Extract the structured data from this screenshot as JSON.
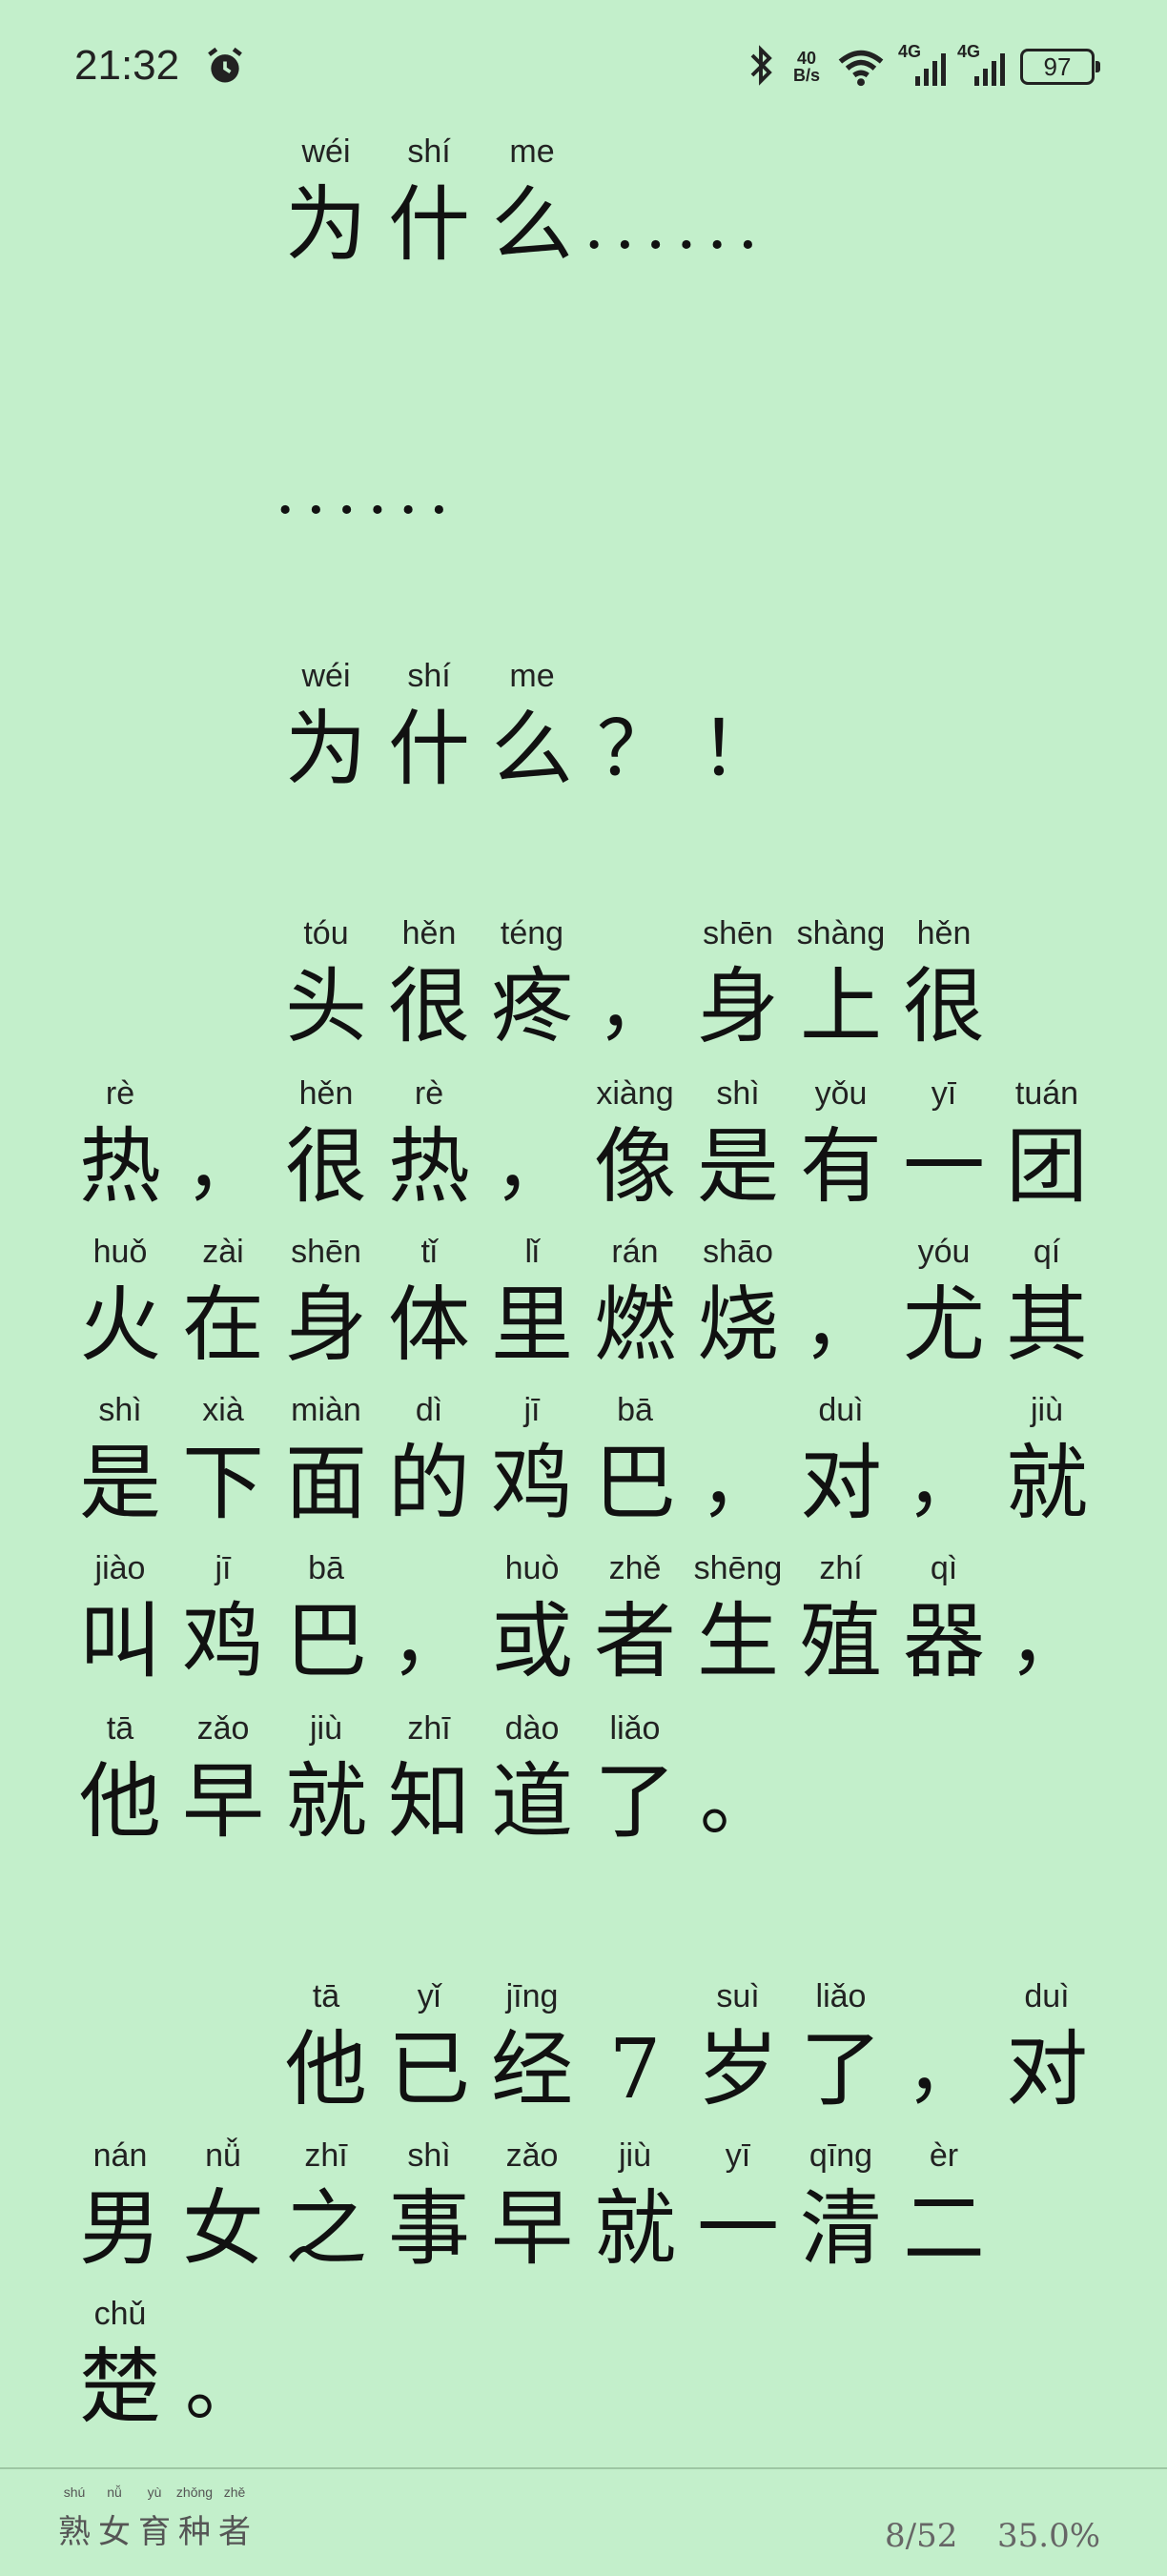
{
  "status_bar": {
    "time": "21:32",
    "net_speed_value": "40",
    "net_speed_unit": "B/s",
    "signal_1": "4G",
    "signal_2": "4G",
    "battery": "97"
  },
  "reader": {
    "lines": [
      [
        {
          "h": "为",
          "p": "wéi"
        },
        {
          "h": "什",
          "p": "shí"
        },
        {
          "h": "么",
          "p": "me"
        },
        {
          "h": "......",
          "p": ""
        }
      ],
      [
        {
          "h": "......",
          "p": ""
        }
      ],
      [
        {
          "h": "为",
          "p": "wéi"
        },
        {
          "h": "什",
          "p": "shí"
        },
        {
          "h": "么",
          "p": "me"
        },
        {
          "h": "？",
          "p": ""
        },
        {
          "h": "！",
          "p": ""
        }
      ],
      [
        {
          "h": "头",
          "p": "tóu"
        },
        {
          "h": "很",
          "p": "hěn"
        },
        {
          "h": "疼",
          "p": "téng"
        },
        {
          "h": "，",
          "p": ""
        },
        {
          "h": "身",
          "p": "shēn"
        },
        {
          "h": "上",
          "p": "shàng"
        },
        {
          "h": "很",
          "p": "hěn"
        }
      ],
      [
        {
          "h": "热",
          "p": "rè"
        },
        {
          "h": "，",
          "p": ""
        },
        {
          "h": "很",
          "p": "hěn"
        },
        {
          "h": "热",
          "p": "rè"
        },
        {
          "h": "，",
          "p": ""
        },
        {
          "h": "像",
          "p": "xiàng"
        },
        {
          "h": "是",
          "p": "shì"
        },
        {
          "h": "有",
          "p": "yǒu"
        },
        {
          "h": "一",
          "p": "yī"
        },
        {
          "h": "团",
          "p": "tuán"
        }
      ],
      [
        {
          "h": "火",
          "p": "huǒ"
        },
        {
          "h": "在",
          "p": "zài"
        },
        {
          "h": "身",
          "p": "shēn"
        },
        {
          "h": "体",
          "p": "tǐ"
        },
        {
          "h": "里",
          "p": "lǐ"
        },
        {
          "h": "燃",
          "p": "rán"
        },
        {
          "h": "烧",
          "p": "shāo"
        },
        {
          "h": "，",
          "p": ""
        },
        {
          "h": "尤",
          "p": "yóu"
        },
        {
          "h": "其",
          "p": "qí"
        }
      ],
      [
        {
          "h": "是",
          "p": "shì"
        },
        {
          "h": "下",
          "p": "xià"
        },
        {
          "h": "面",
          "p": "miàn"
        },
        {
          "h": "的",
          "p": "dì"
        },
        {
          "h": "鸡",
          "p": "jī"
        },
        {
          "h": "巴",
          "p": "bā"
        },
        {
          "h": "，",
          "p": ""
        },
        {
          "h": "对",
          "p": "duì"
        },
        {
          "h": "，",
          "p": ""
        },
        {
          "h": "就",
          "p": "jiù"
        }
      ],
      [
        {
          "h": "叫",
          "p": "jiào"
        },
        {
          "h": "鸡",
          "p": "jī"
        },
        {
          "h": "巴",
          "p": "bā"
        },
        {
          "h": "，",
          "p": ""
        },
        {
          "h": "或",
          "p": "huò"
        },
        {
          "h": "者",
          "p": "zhě"
        },
        {
          "h": "生",
          "p": "shēng"
        },
        {
          "h": "殖",
          "p": "zhí"
        },
        {
          "h": "器",
          "p": "qì"
        },
        {
          "h": "，",
          "p": ""
        }
      ],
      [
        {
          "h": "他",
          "p": "tā"
        },
        {
          "h": "早",
          "p": "zǎo"
        },
        {
          "h": "就",
          "p": "jiù"
        },
        {
          "h": "知",
          "p": "zhī"
        },
        {
          "h": "道",
          "p": "dào"
        },
        {
          "h": "了",
          "p": "liǎo"
        },
        {
          "h": "。",
          "p": ""
        }
      ],
      [
        {
          "h": "他",
          "p": "tā"
        },
        {
          "h": "已",
          "p": "yǐ"
        },
        {
          "h": "经",
          "p": "jīng"
        },
        {
          "h": "7",
          "p": ""
        },
        {
          "h": "岁",
          "p": "suì"
        },
        {
          "h": "了",
          "p": "liǎo"
        },
        {
          "h": "，",
          "p": ""
        },
        {
          "h": "对",
          "p": "duì"
        }
      ],
      [
        {
          "h": "男",
          "p": "nán"
        },
        {
          "h": "女",
          "p": "nǚ"
        },
        {
          "h": "之",
          "p": "zhī"
        },
        {
          "h": "事",
          "p": "shì"
        },
        {
          "h": "早",
          "p": "zǎo"
        },
        {
          "h": "就",
          "p": "jiù"
        },
        {
          "h": "一",
          "p": "yī"
        },
        {
          "h": "清",
          "p": "qīng"
        },
        {
          "h": "二",
          "p": "èr"
        }
      ],
      [
        {
          "h": "楚",
          "p": "chǔ"
        },
        {
          "h": "。",
          "p": ""
        }
      ]
    ]
  },
  "footer": {
    "book_title": [
      {
        "h": "熟",
        "p": "shú"
      },
      {
        "h": "女",
        "p": "nǚ"
      },
      {
        "h": "育",
        "p": "yù"
      },
      {
        "h": "种",
        "p": "zhǒng"
      },
      {
        "h": "者",
        "p": "zhě"
      }
    ],
    "page": "8/52",
    "progress": "35.0%"
  },
  "icons": {
    "alarm": "alarm-clock-icon",
    "bluetooth": "bluetooth-icon",
    "wifi": "wifi-icon",
    "signal": "cell-signal-icon",
    "battery": "battery-icon"
  }
}
